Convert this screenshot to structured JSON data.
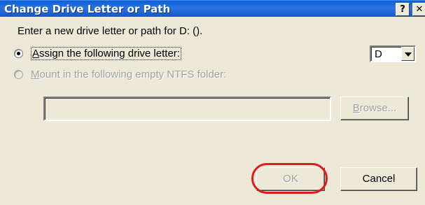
{
  "window": {
    "title": "Change Drive Letter or Path",
    "help_label": "?",
    "close_label": "✕"
  },
  "dialog": {
    "prompt": "Enter a new drive letter or path for D: ().",
    "assign_option": {
      "first": "A",
      "rest": "ssign the following drive letter:",
      "selected": true
    },
    "mount_option": {
      "first": "M",
      "rest": "ount in the following empty NTFS folder:",
      "selected": false,
      "disabled": true
    },
    "drive_letter": "D",
    "folder_path": "",
    "browse_button": {
      "first": "B",
      "rest": "rowse...",
      "disabled": true
    },
    "ok_button": {
      "label": "OK",
      "disabled": true
    },
    "cancel_button": {
      "label": "Cancel"
    },
    "highlight_color": "#e11a1a"
  }
}
